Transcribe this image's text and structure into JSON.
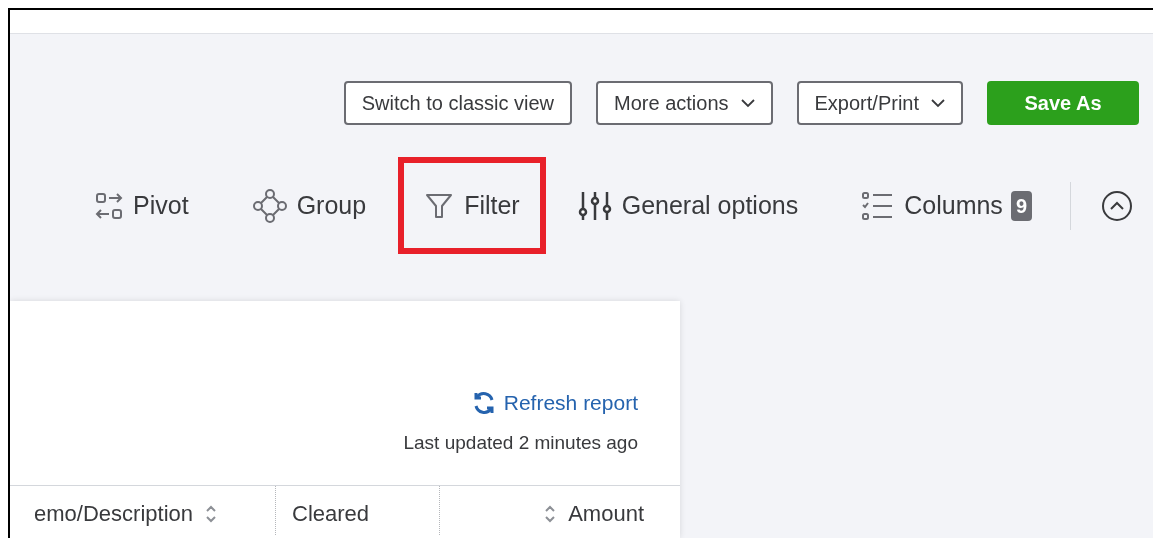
{
  "actions": [
    {
      "label": "Switch to classic view",
      "kind": "outline",
      "dropdown": false
    },
    {
      "label": "More actions",
      "kind": "outline",
      "dropdown": true
    },
    {
      "label": "Export/Print",
      "kind": "outline",
      "dropdown": true
    },
    {
      "label": "Save As",
      "kind": "primary",
      "dropdown": false
    }
  ],
  "toolbar": [
    {
      "label": "Pivot",
      "kind": "pivot",
      "highlighted": false
    },
    {
      "label": "Group",
      "kind": "group",
      "highlighted": false
    },
    {
      "label": "Filter",
      "kind": "filter",
      "highlighted": true
    },
    {
      "label": "General options",
      "kind": "options",
      "highlighted": false
    },
    {
      "label": "Columns",
      "kind": "columns",
      "highlighted": false,
      "badge": "9"
    }
  ],
  "report": {
    "refresh": "Refresh report",
    "last_updated": "Last updated 2 minutes ago",
    "columns": [
      {
        "label": "emo/Description",
        "kind": "text"
      },
      {
        "label": "Cleared",
        "kind": "plain"
      },
      {
        "label": "Amount",
        "kind": "numeric"
      }
    ]
  }
}
